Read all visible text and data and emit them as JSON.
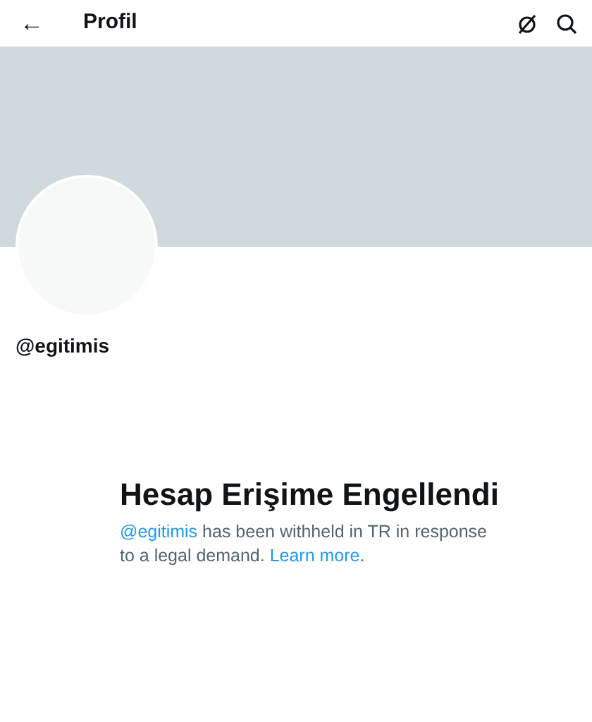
{
  "header": {
    "back": "←",
    "title": "Profil"
  },
  "profile": {
    "handle": "@egitimis"
  },
  "notice": {
    "title": "Hesap Erişime Engellendi",
    "message": [
      {
        "kind": "link",
        "text": "@egitimis"
      },
      {
        "kind": "text",
        "text": " has been withheld in TR in response to a legal demand. "
      },
      {
        "kind": "link",
        "text": "Learn more"
      },
      {
        "kind": "text",
        "text": "."
      }
    ]
  }
}
